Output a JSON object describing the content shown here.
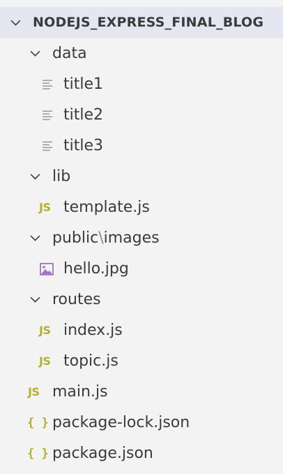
{
  "explorer": {
    "project_title": "NODEJS_EXPRESS_FINAL_BLOG",
    "data_folder": {
      "label": "data",
      "files": [
        "title1",
        "title2",
        "title3"
      ]
    },
    "lib_folder": {
      "label": "lib",
      "files": [
        "template.js"
      ]
    },
    "public_folder": {
      "label_public": "public",
      "separator": "\\",
      "label_images": "images",
      "files": [
        "hello.jpg"
      ]
    },
    "routes_folder": {
      "label": "routes",
      "files": [
        "index.js",
        "topic.js"
      ]
    },
    "root_files": [
      "main.js",
      "package-lock.json",
      "package.json"
    ],
    "icons": {
      "js_label": "JS",
      "json_label": "{ }"
    }
  },
  "colors": {
    "header_bg": "#e4e6f1",
    "panel_bg": "#f3f3f3",
    "js_color": "#b3b12a",
    "image_icon_color": "#a074c4"
  }
}
